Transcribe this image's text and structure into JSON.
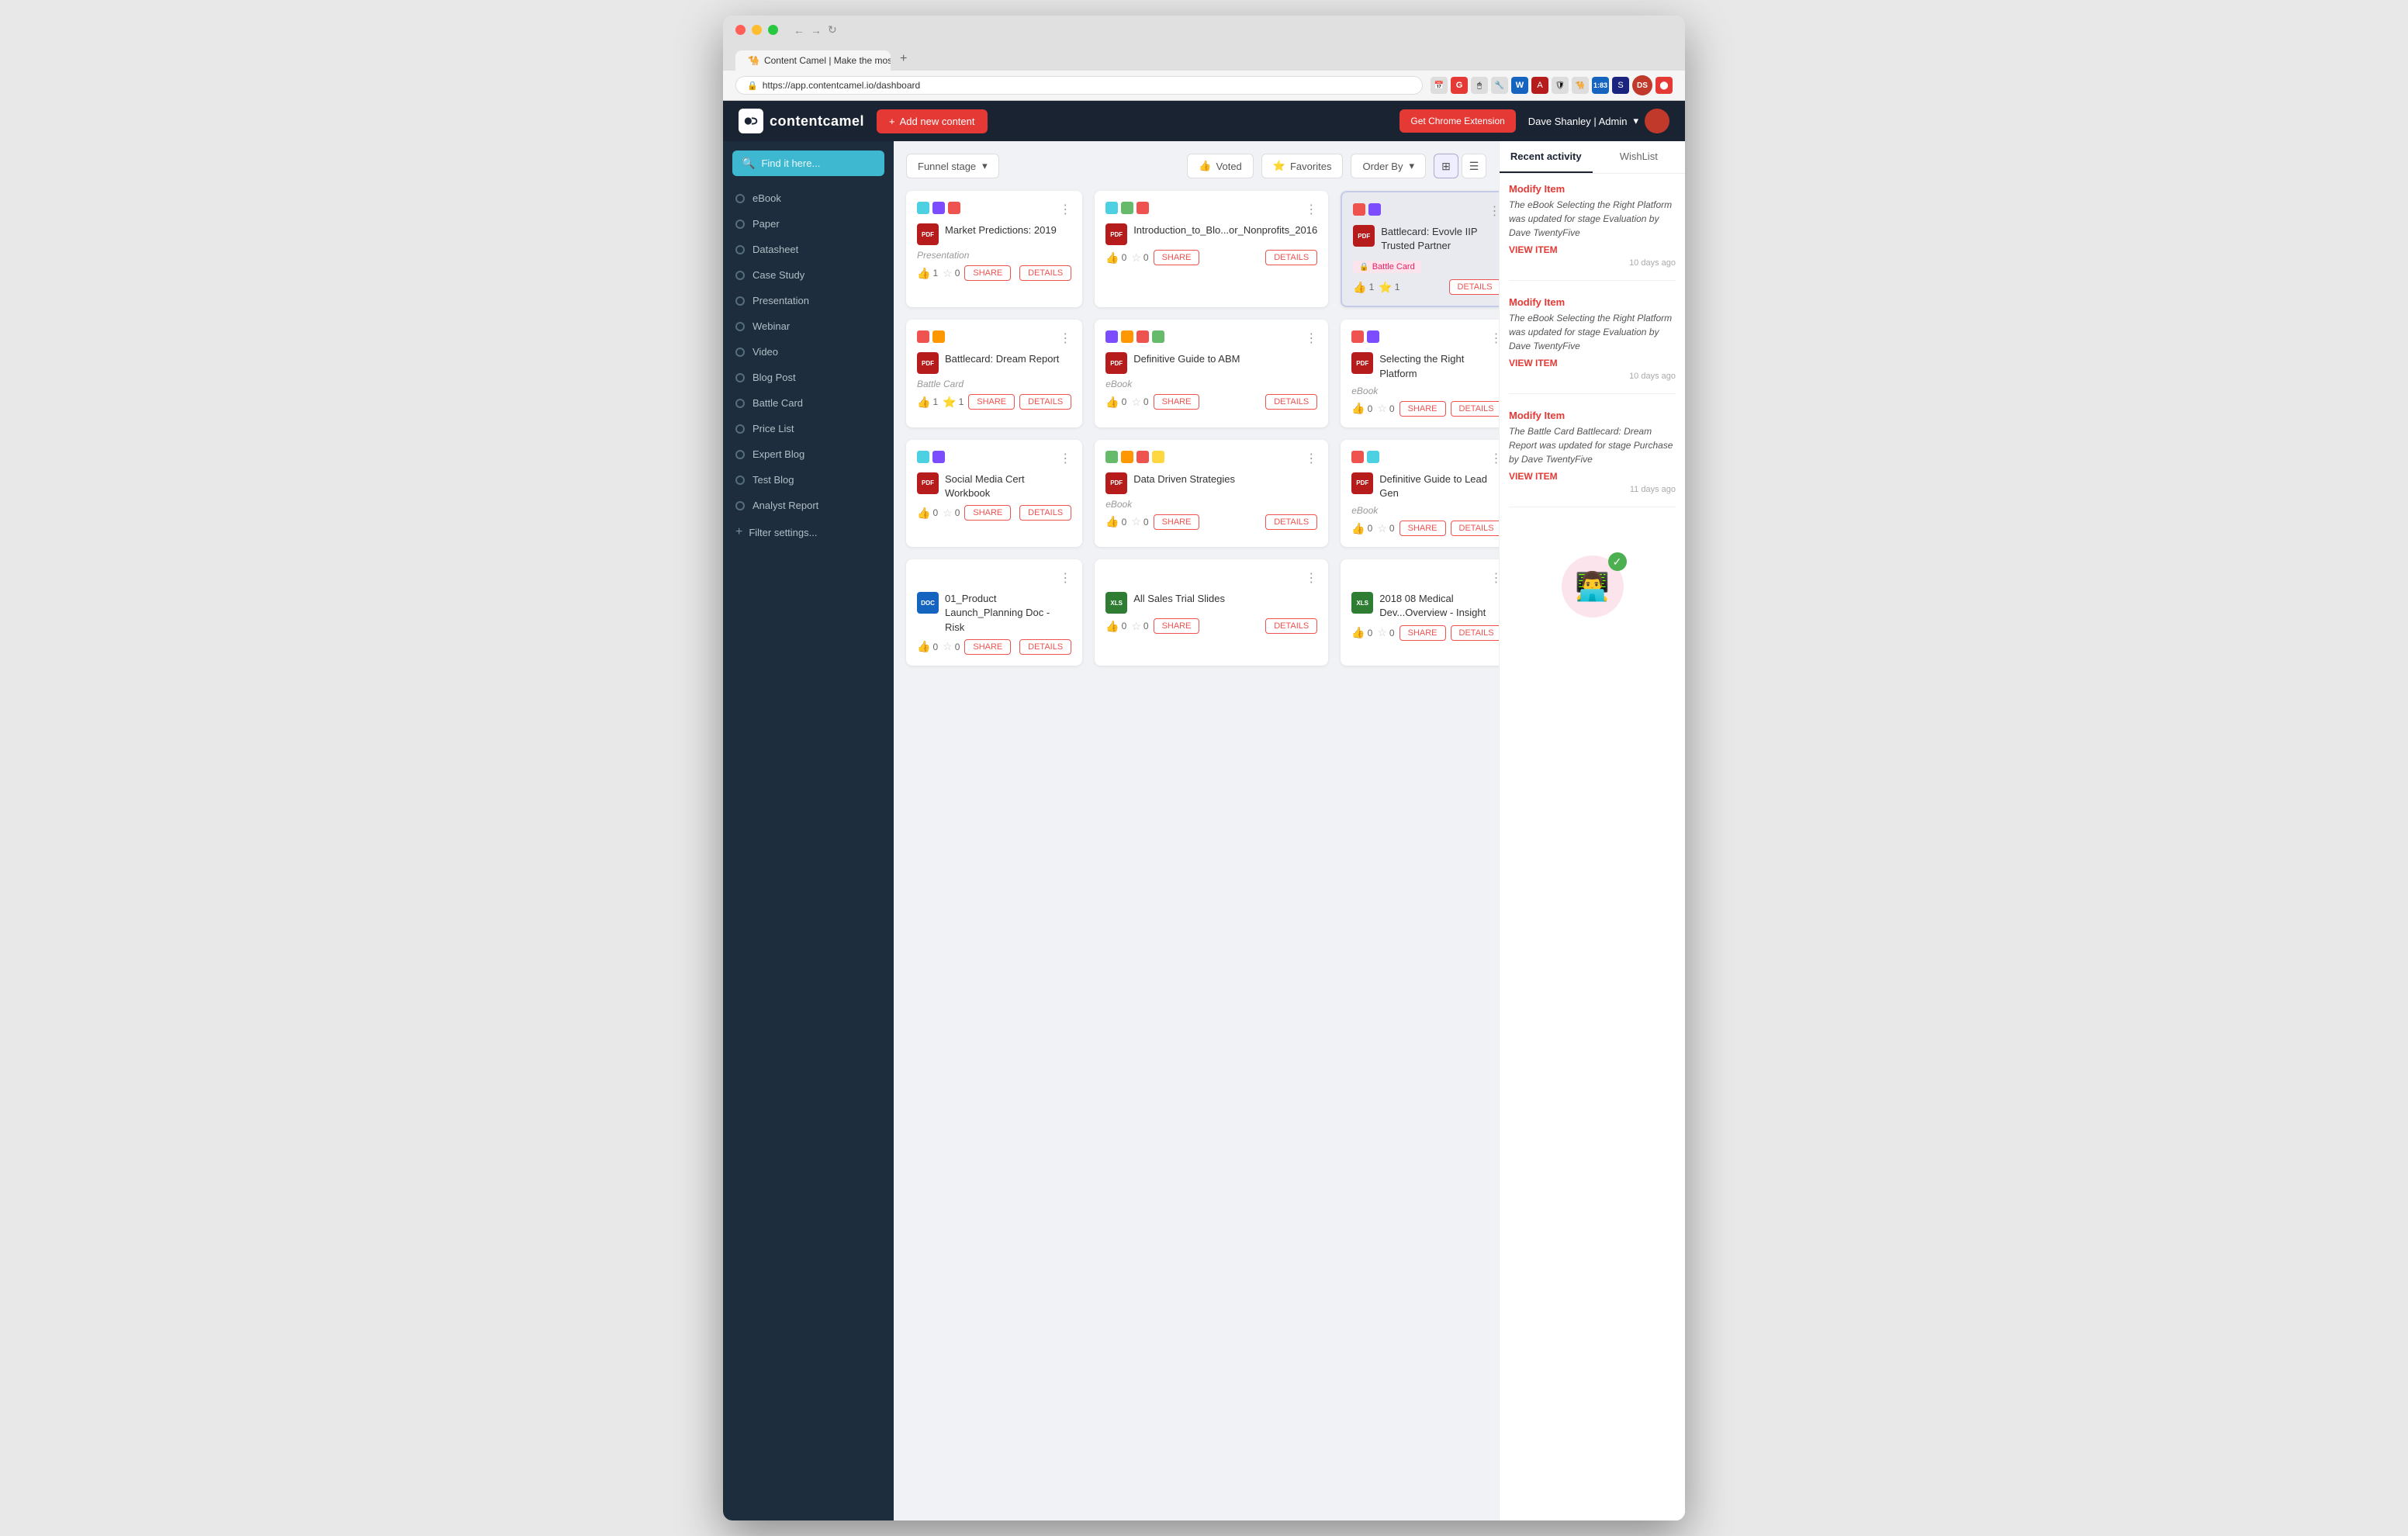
{
  "browser": {
    "tab_title": "Content Camel | Make the mos...",
    "url": "https://app.contentcamel.io/dashboard",
    "new_tab_label": "+",
    "tab_close": "×"
  },
  "header": {
    "logo_text": "contentcamel",
    "add_content_label": "Add new content",
    "chrome_ext_label": "Get Chrome Extension",
    "user_label": "Dave Shanley | Admin",
    "user_dropdown": "▾"
  },
  "sidebar": {
    "search_placeholder": "Find it here...",
    "items": [
      {
        "id": "ebook",
        "label": "eBook"
      },
      {
        "id": "paper",
        "label": "Paper"
      },
      {
        "id": "datasheet",
        "label": "Datasheet"
      },
      {
        "id": "case-study",
        "label": "Case Study"
      },
      {
        "id": "presentation",
        "label": "Presentation"
      },
      {
        "id": "webinar",
        "label": "Webinar"
      },
      {
        "id": "video",
        "label": "Video"
      },
      {
        "id": "blog-post",
        "label": "Blog Post"
      },
      {
        "id": "battle-card",
        "label": "Battle Card"
      },
      {
        "id": "price-list",
        "label": "Price List"
      },
      {
        "id": "expert-blog",
        "label": "Expert Blog"
      },
      {
        "id": "test-blog",
        "label": "Test Blog"
      },
      {
        "id": "analyst-report",
        "label": "Analyst Report"
      }
    ],
    "filter_label": "Filter settings..."
  },
  "toolbar": {
    "funnel_label": "Funnel stage",
    "voted_label": "Voted",
    "favorites_label": "Favorites",
    "order_by_label": "Order By"
  },
  "cards": [
    {
      "id": "card-1",
      "title": "Market Predictions: 2019",
      "type": "Presentation",
      "file_type": "pdf",
      "tags": [
        "teal",
        "purple",
        "red"
      ],
      "likes": 1,
      "stars": 0,
      "highlighted": false,
      "has_share": true,
      "has_details": true,
      "badge": null
    },
    {
      "id": "card-2",
      "title": "Introduction_to_Blo...or_Nonprofits_2016",
      "type": "",
      "file_type": "pdf",
      "tags": [
        "teal",
        "green",
        "red"
      ],
      "likes": 0,
      "stars": 0,
      "highlighted": false,
      "has_share": true,
      "has_details": true,
      "badge": null
    },
    {
      "id": "card-3",
      "title": "Battlecard: Evovle IIP Trusted Partner",
      "type": "",
      "file_type": "pdf",
      "tags": [
        "red",
        "purple"
      ],
      "likes": 1,
      "stars": 1,
      "highlighted": true,
      "has_share": false,
      "has_details": true,
      "badge": "Battle Card"
    },
    {
      "id": "card-4",
      "title": "Battlecard: Dream Report",
      "type": "Battle Card",
      "file_type": "pdf",
      "tags": [
        "red",
        "orange"
      ],
      "likes": 1,
      "stars": 1,
      "highlighted": false,
      "has_share": true,
      "has_details": true,
      "badge": null
    },
    {
      "id": "card-5",
      "title": "Definitive Guide to ABM",
      "type": "eBook",
      "file_type": "pdf",
      "tags": [
        "purple",
        "orange",
        "red",
        "green"
      ],
      "likes": 0,
      "stars": 0,
      "highlighted": false,
      "has_share": true,
      "has_details": true,
      "badge": null
    },
    {
      "id": "card-6",
      "title": "Selecting the Right Platform",
      "type": "eBook",
      "file_type": "pdf",
      "tags": [
        "red",
        "purple"
      ],
      "likes": 0,
      "stars": 0,
      "highlighted": false,
      "has_share": true,
      "has_details": true,
      "badge": null
    },
    {
      "id": "card-7",
      "title": "Social Media Cert Workbook",
      "type": "",
      "file_type": "pdf",
      "tags": [
        "teal",
        "purple"
      ],
      "likes": 0,
      "stars": 0,
      "highlighted": false,
      "has_share": true,
      "has_details": true,
      "badge": null
    },
    {
      "id": "card-8",
      "title": "Data Driven Strategies",
      "type": "eBook",
      "file_type": "pdf",
      "tags": [
        "green",
        "orange",
        "red",
        "yellow"
      ],
      "likes": 0,
      "stars": 0,
      "highlighted": false,
      "has_share": true,
      "has_details": true,
      "badge": null
    },
    {
      "id": "card-9",
      "title": "Definitive Guide to Lead Gen",
      "type": "eBook",
      "file_type": "pdf",
      "tags": [
        "red",
        "teal"
      ],
      "likes": 0,
      "stars": 0,
      "highlighted": false,
      "has_share": true,
      "has_details": true,
      "badge": null
    },
    {
      "id": "card-10",
      "title": "01_Product Launch_Planning Doc - Risk",
      "type": "",
      "file_type": "docx",
      "tags": [],
      "likes": 0,
      "stars": 0,
      "highlighted": false,
      "has_share": true,
      "has_details": true,
      "badge": null
    },
    {
      "id": "card-11",
      "title": "All Sales Trial Slides",
      "type": "",
      "file_type": "xlsx",
      "tags": [],
      "likes": 0,
      "stars": 0,
      "highlighted": false,
      "has_share": true,
      "has_details": true,
      "badge": null
    },
    {
      "id": "card-12",
      "title": "2018 08 Medical Dev...Overview - Insight",
      "type": "",
      "file_type": "xlsx",
      "tags": [],
      "likes": 0,
      "stars": 0,
      "highlighted": false,
      "has_share": true,
      "has_details": true,
      "badge": null
    }
  ],
  "right_panel": {
    "tabs": [
      {
        "id": "recent",
        "label": "Recent activity"
      },
      {
        "id": "wishlist",
        "label": "WishList"
      }
    ],
    "activities": [
      {
        "action": "Modify Item",
        "desc": "The eBook Selecting the Right Platform was updated for stage Evaluation by Dave TwentyFive",
        "link": "VIEW ITEM",
        "time": "10 days ago"
      },
      {
        "action": "Modify Item",
        "desc": "The eBook Selecting the Right Platform was updated for stage Evaluation by Dave TwentyFive",
        "link": "VIEW ITEM",
        "time": "10 days ago"
      },
      {
        "action": "Modify Item",
        "desc": "The Battle Card Battlecard: Dream Report was updated for stage Purchase by Dave TwentyFive",
        "link": "VIEW ITEM",
        "time": "11 days ago"
      }
    ]
  }
}
